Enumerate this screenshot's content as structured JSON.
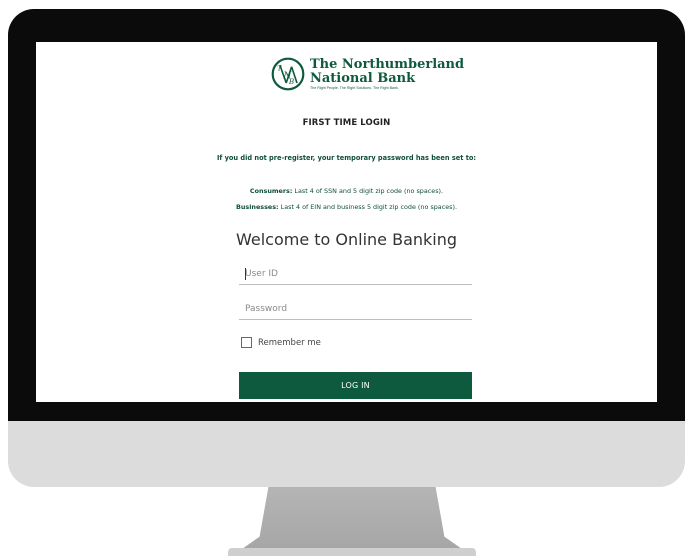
{
  "bank": {
    "name_line1": "The Northumberland",
    "name_line2": "National Bank",
    "tagline": "The Right People. The Right Solutions. The Right Bank.",
    "brand_color": "#0e5a3e"
  },
  "page": {
    "title": "FIRST TIME LOGIN",
    "notice": "If you did not pre-register, your temporary password has been set to:",
    "consumers_label": "Consumers:",
    "consumers_text": " Last 4 of SSN and 5 digit zip code (no spaces).",
    "businesses_label": "Businesses:",
    "businesses_text": " Last 4 of EIN and business 5 digit zip code (no spaces).",
    "welcome": "Welcome to Online Banking"
  },
  "form": {
    "user_placeholder": "User ID",
    "password_placeholder": "Password",
    "remember_label": "Remember me",
    "remember_checked": false,
    "login_label": "LOG IN"
  }
}
